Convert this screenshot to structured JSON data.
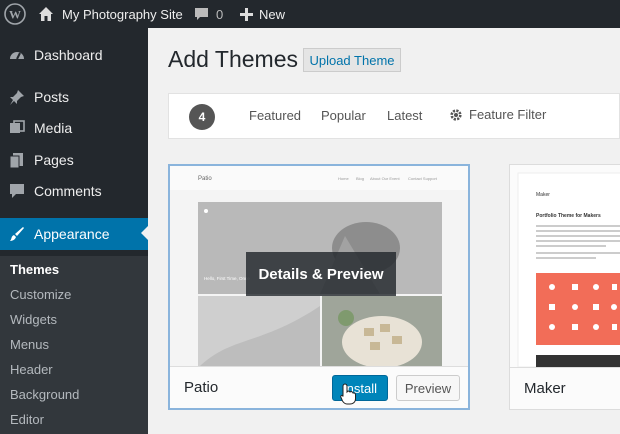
{
  "adminbar": {
    "site_name": "My Photography Site",
    "comment_count": "0",
    "new_label": "New",
    "icons": [
      "wordpress-icon",
      "home-icon",
      "comment-icon",
      "plus-icon"
    ]
  },
  "sidebar": {
    "items": [
      {
        "label": "Dashboard",
        "icon": "dashboard-icon"
      },
      {
        "label": "Posts",
        "icon": "pin-icon"
      },
      {
        "label": "Media",
        "icon": "media-icon"
      },
      {
        "label": "Pages",
        "icon": "pages-icon"
      },
      {
        "label": "Comments",
        "icon": "comment-icon"
      },
      {
        "label": "Appearance",
        "icon": "brush-icon",
        "active": true
      }
    ],
    "submenu": [
      "Themes",
      "Customize",
      "Widgets",
      "Menus",
      "Header",
      "Background",
      "Editor"
    ]
  },
  "header": {
    "title": "Add Themes",
    "upload_label": "Upload Theme"
  },
  "filter": {
    "count": "4",
    "tabs": [
      "Featured",
      "Popular",
      "Latest"
    ],
    "feature_filter": "Feature Filter"
  },
  "themes": [
    {
      "name": "Patio",
      "install_label": "Install",
      "preview_label": "Preview",
      "overlay_label": "Details & Preview",
      "shot": {
        "site_title": "Patio",
        "nav": [
          "Home",
          "Blog",
          "About Our Event",
          "Contact Support"
        ],
        "caption": "Hello, First Time, Once"
      }
    },
    {
      "name": "Maker",
      "shot": {
        "site_title": "Maker",
        "heading": "Portfolio Theme for Makers"
      }
    }
  ],
  "colors": {
    "admin_dark": "#23282d",
    "accent": "#0073aa",
    "install": "#0085ba",
    "maker_orange": "#f26d58"
  }
}
